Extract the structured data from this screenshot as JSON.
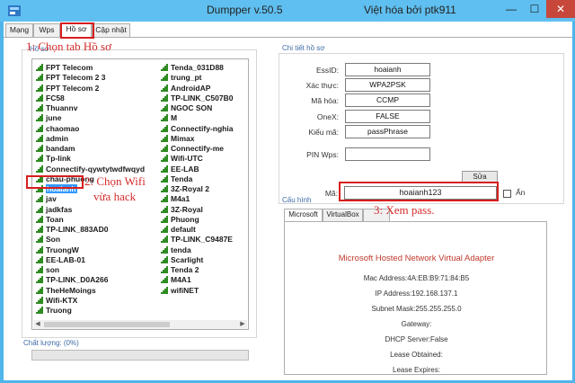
{
  "window": {
    "title": "Dumpper v.50.5",
    "credit": "Việt hóa bởi ptk911",
    "minimize": "—",
    "maximize": "☐",
    "close": "✕"
  },
  "tabs": [
    "Mạng",
    "Wps",
    "Hồ sơ",
    "Cập nhật"
  ],
  "left_group_label": "Hồ sơ",
  "wifi_list": {
    "col1": [
      "FPT Telecom",
      "FPT Telecom 2 3",
      "FPT Telecom 2",
      "FC58",
      "Thuannv",
      "june",
      "chaomao",
      "admin",
      "bandam",
      "Tp-link",
      "Connectify-qywtytwdfwqyd",
      "chau-phuong",
      "hoaianh",
      "jav",
      "jadkfas",
      "Toan",
      "TP-LINK_883AD0",
      "Son",
      "TruongW",
      "EE-LAB-01",
      "son",
      "TP-LINK_D0A266",
      "TheHeMoings",
      "Wifi-KTX",
      "Truong"
    ],
    "col2": [
      "Tenda_031D88",
      "trung_pt",
      "AndroidAP",
      "TP-LINK_C507B0",
      "NGOC SON",
      "M",
      "Connectify-nghia",
      "Mimax",
      "Connectify-me",
      "Wifi-UTC",
      "EE-LAB",
      "Tenda",
      "3Z-Royal 2",
      "M4a1",
      "3Z-Royal",
      "Phuong",
      "default",
      "TP-LINK_C9487E",
      "tenda",
      "Scarlight",
      "Tenda 2",
      "M4A1",
      "wifiNET"
    ],
    "selected": "hoaianh"
  },
  "quality_label": "Chất lượng: (0%)",
  "details": {
    "group_label": "Chi tiết hồ sơ",
    "fields": [
      {
        "label": "EssID:",
        "value": "hoaianh"
      },
      {
        "label": "Xác thực:",
        "value": "WPA2PSK"
      },
      {
        "label": "Mã hóa:",
        "value": "CCMP"
      },
      {
        "label": "OneX:",
        "value": "FALSE"
      },
      {
        "label": "Kiểu mã:",
        "value": "passPhrase"
      },
      {
        "label": "PIN Wps:",
        "value": ""
      }
    ],
    "sua_button": "Sửa",
    "password_label": "Mã:",
    "password_value": "hoaianh123",
    "show_label": "Ẩn"
  },
  "config": {
    "group_label": "Cấu hình",
    "tabs": [
      "Microsoft",
      "VirtualBox"
    ],
    "adapter_title": "Microsoft Hosted Network Virtual Adapter",
    "lines": [
      "Mac Address:4A:EB:B9:71:84:B5",
      "IP Address:192.168.137.1",
      "Subnet Mask:255.255.255.0",
      "Gateway:",
      "DHCP Server:False",
      "Lease Obtained:",
      "Lease Expires:"
    ]
  },
  "annotations": {
    "step1": "1: Chọn tab Hồ sơ",
    "step2_line1": "2: Chọn Wifi",
    "step2_line2": "vừa hack",
    "step3": "3: Xem pass."
  },
  "colors": {
    "annotation_red": "#d52b2b",
    "selection_blue": "#3399ff",
    "signal_green": "#2e8b22"
  }
}
